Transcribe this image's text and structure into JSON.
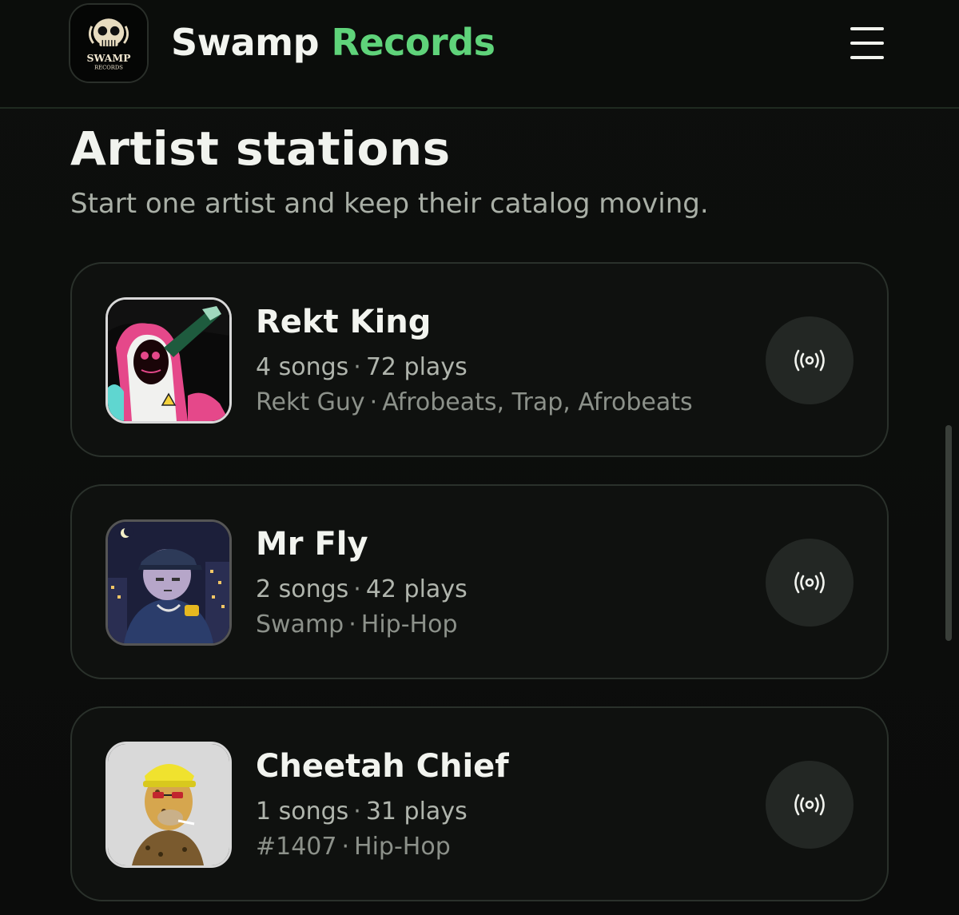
{
  "header": {
    "brand_word1": "Swamp",
    "brand_word2": "Records",
    "logo_text": "SWAMP",
    "logo_subtext": "RECORDS",
    "menu_icon": "hamburger-icon"
  },
  "section": {
    "title": "Artist stations",
    "subtitle": "Start one artist and keep their catalog moving."
  },
  "stations": [
    {
      "name": "Rekt King",
      "songs": "4 songs",
      "plays": "72 plays",
      "creator": "Rekt Guy",
      "genres": "Afrobeats, Trap, Afrobeats"
    },
    {
      "name": "Mr Fly",
      "songs": "2 songs",
      "plays": "42 plays",
      "creator": "Swamp",
      "genres": "Hip-Hop"
    },
    {
      "name": "Cheetah Chief",
      "songs": "1 songs",
      "plays": "31 plays",
      "creator": "#1407",
      "genres": "Hip-Hop"
    }
  ],
  "colors": {
    "accent_green": "#5fd37a",
    "background": "#0c0d0c",
    "card_border": "#2a312b",
    "button_bg": "#232724"
  }
}
